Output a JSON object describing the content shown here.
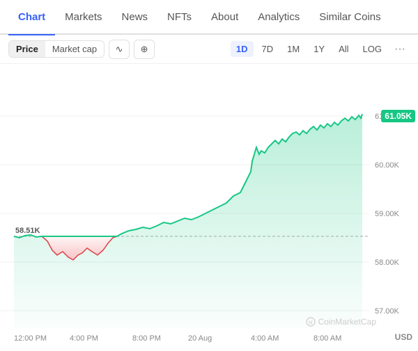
{
  "tabs": [
    {
      "label": "Chart",
      "active": true
    },
    {
      "label": "Markets",
      "active": false
    },
    {
      "label": "News",
      "active": false
    },
    {
      "label": "NFTs",
      "active": false
    },
    {
      "label": "About",
      "active": false
    },
    {
      "label": "Analytics",
      "active": false
    },
    {
      "label": "Similar Coins",
      "active": false
    }
  ],
  "toolbar": {
    "price_label": "Price",
    "marketcap_label": "Market cap",
    "line_icon": "∿",
    "dollar_icon": "⊕",
    "time_buttons": [
      "1D",
      "7D",
      "1M",
      "1Y",
      "All",
      "LOG"
    ],
    "active_time": "1D",
    "more_icon": "···"
  },
  "chart": {
    "current_price": "61.05K",
    "start_price": "58.51K",
    "y_labels": [
      "57.00K",
      "58.00K",
      "59.00K",
      "60.00K",
      "61.00K"
    ],
    "x_labels": [
      "12:00 PM",
      "4:00 PM",
      "8:00 PM",
      "20 Aug",
      "4:00 AM",
      "8:00 AM"
    ],
    "watermark": "CoinMarketCap",
    "currency": "USD",
    "price_color": "#16c784",
    "loss_color": "#ea3943"
  }
}
